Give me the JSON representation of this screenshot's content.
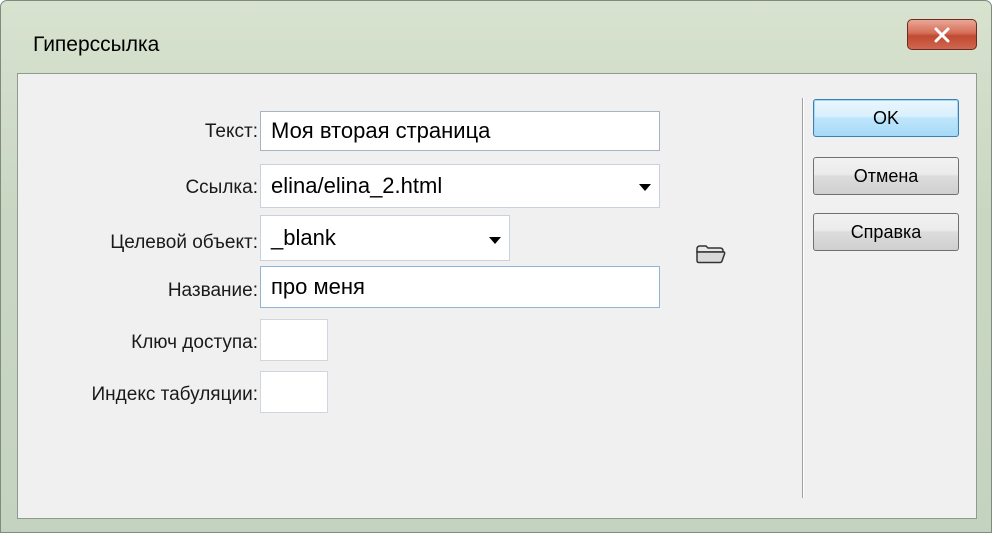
{
  "window": {
    "title": "Гиперссылка"
  },
  "form": {
    "text": {
      "label": "Текст:",
      "value": "Моя вторая страница"
    },
    "link": {
      "label": "Ссылка:",
      "value": "elina/elina_2.html"
    },
    "target": {
      "label": "Целевой объект:",
      "value": "_blank"
    },
    "name": {
      "label": "Название:",
      "value": "про меня"
    },
    "access_key": {
      "label": "Ключ доступа:",
      "value": ""
    },
    "tab_index": {
      "label": "Индекс табуляции:",
      "value": ""
    }
  },
  "buttons": {
    "ok": "OK",
    "cancel": "Отмена",
    "help": "Справка"
  },
  "icons": {
    "close": "close-icon",
    "folder": "folder-icon",
    "dropdown": "chevron-down-icon"
  },
  "colors": {
    "close_button": "#c04a31",
    "default_button_border": "#3c7fb1",
    "dialog_background": "#f0f0f0"
  }
}
